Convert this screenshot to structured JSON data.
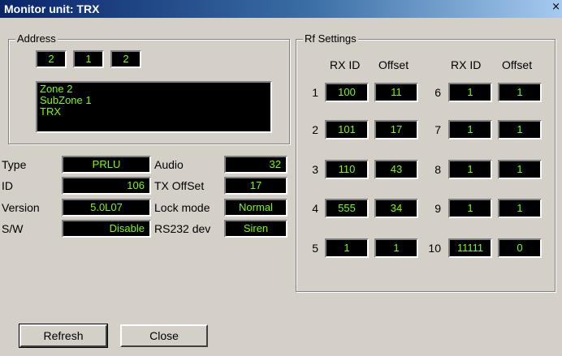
{
  "window": {
    "title": "Monitor unit: TRX",
    "close_glyph": "×"
  },
  "address": {
    "label": "Address",
    "fields": [
      "2",
      "1",
      "2"
    ],
    "zone_lines": [
      "Zone 2",
      "SubZone 1",
      "TRX"
    ]
  },
  "info": {
    "type_label": "Type",
    "type_value": "PRLU",
    "id_label": "ID",
    "id_value": "106",
    "version_label": "Version",
    "version_value": "5.0L07",
    "sw_label": "S/W",
    "sw_value": "Disable",
    "audio_label": "Audio",
    "audio_value": "32",
    "txoffset_label": "TX OffSet",
    "txoffset_value": "17",
    "lockmode_label": "Lock mode",
    "lockmode_value": "Normal",
    "rs232_label": "RS232 dev",
    "rs232_value": "Siren"
  },
  "rf": {
    "label": "Rf Settings",
    "col_rxid": "RX ID",
    "col_offset": "Offset",
    "rows_left": [
      {
        "num": "1",
        "rxid": "100",
        "offset": "11"
      },
      {
        "num": "2",
        "rxid": "101",
        "offset": "17"
      },
      {
        "num": "3",
        "rxid": "110",
        "offset": "43"
      },
      {
        "num": "4",
        "rxid": "555",
        "offset": "34"
      },
      {
        "num": "5",
        "rxid": "1",
        "offset": "1"
      }
    ],
    "rows_right": [
      {
        "num": "6",
        "rxid": "1",
        "offset": "1"
      },
      {
        "num": "7",
        "rxid": "1",
        "offset": "1"
      },
      {
        "num": "8",
        "rxid": "1",
        "offset": "1"
      },
      {
        "num": "9",
        "rxid": "1",
        "offset": "1"
      },
      {
        "num": "10",
        "rxid": "11111",
        "offset": "0"
      }
    ]
  },
  "buttons": {
    "refresh": "Refresh",
    "close": "Close"
  },
  "colors": {
    "lcd_text": "#7cfc00",
    "lcd_bg": "#000000",
    "face": "#d4d0c8"
  }
}
